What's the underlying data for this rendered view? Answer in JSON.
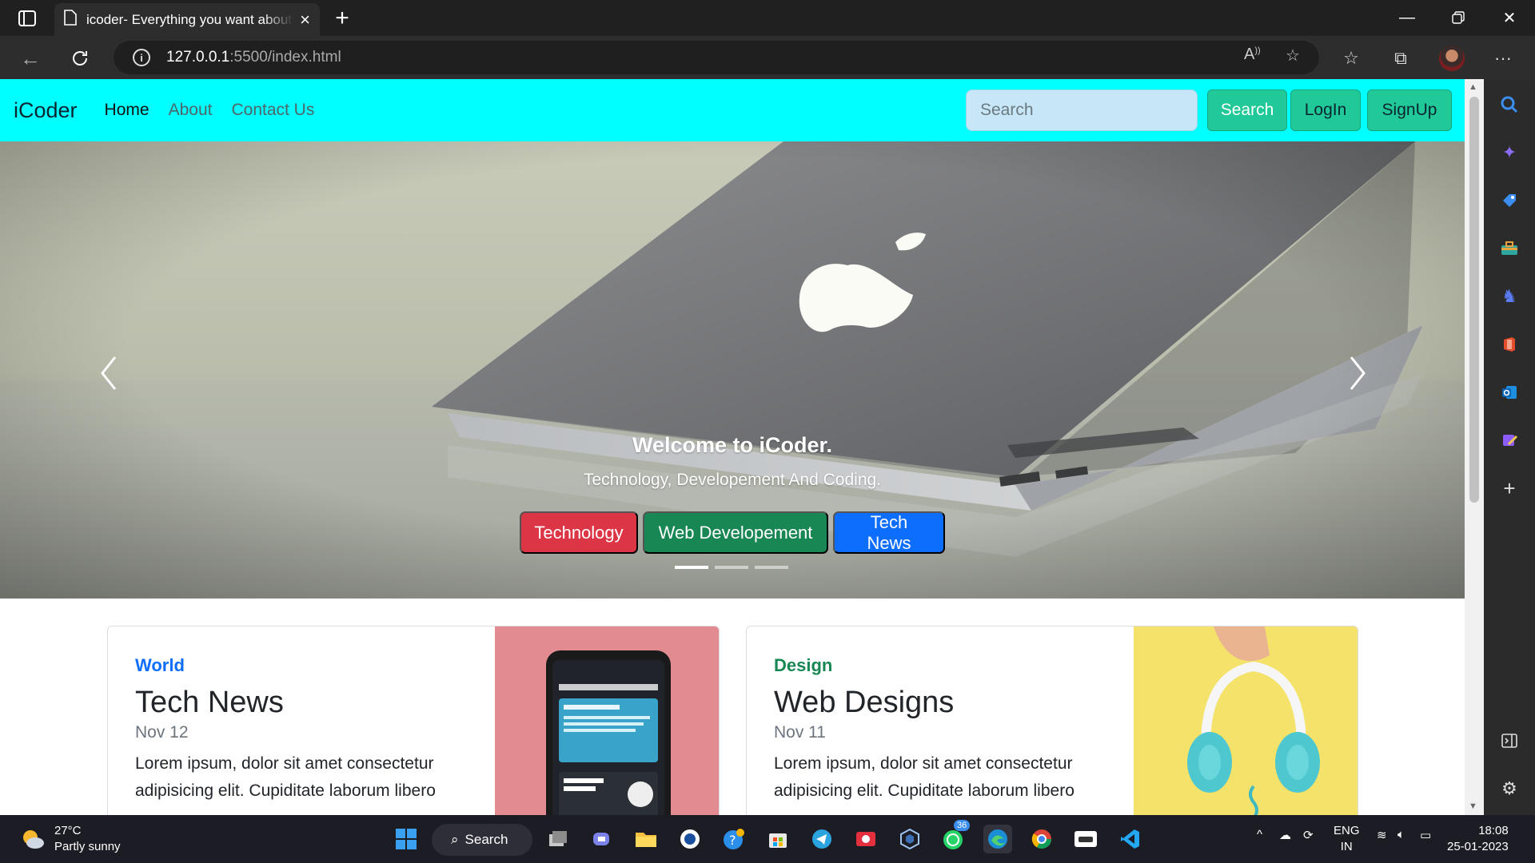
{
  "browser": {
    "tab_title": "icoder- Everything you want about coding",
    "url_host": "127.0.0.1",
    "url_path": ":5500/index.html"
  },
  "site": {
    "brand": "iCoder",
    "nav": {
      "home": "Home",
      "about": "About",
      "contact": "Contact Us"
    },
    "search_placeholder": "Search",
    "buttons": {
      "search": "Search",
      "login": "LogIn",
      "signup": "SignUp"
    }
  },
  "carousel": {
    "title": "Welcome to iCoder.",
    "subtitle": "Technology, Developement And Coding.",
    "buttons": [
      "Technology",
      "Web Developement",
      "Tech News"
    ],
    "active_slide": 1,
    "slide_count": 3
  },
  "cards": [
    {
      "category": "World",
      "title": "Tech News",
      "date": "Nov 12",
      "text": "Lorem ipsum, dolor sit amet consectetur adipisicing elit. Cupiditate laborum libero"
    },
    {
      "category": "Design",
      "title": "Web Designs",
      "date": "Nov 11",
      "text": "Lorem ipsum, dolor sit amet consectetur adipisicing elit. Cupiditate laborum libero"
    }
  ],
  "taskbar": {
    "temp": "27°C",
    "weather": "Partly sunny",
    "search": "Search",
    "whatsapp_badge": "36",
    "lang": "ENG",
    "region": "IN",
    "time": "18:08",
    "date": "25-01-2023"
  },
  "colors": {
    "navbar": "#00ffff",
    "green": "#20c997",
    "danger": "#dc3545",
    "success": "#198754",
    "primary": "#0d6efd"
  }
}
